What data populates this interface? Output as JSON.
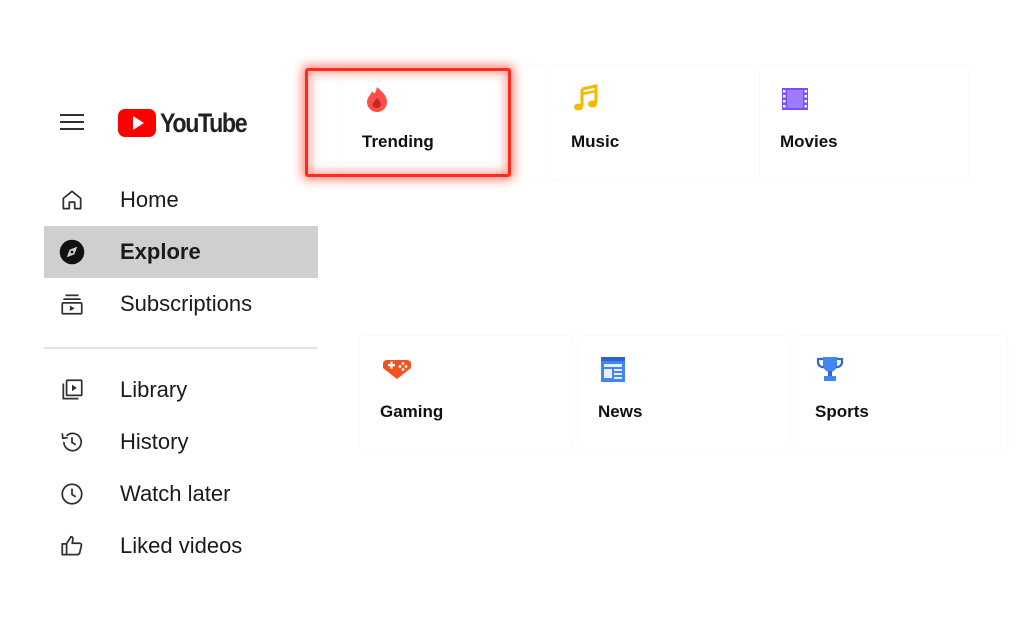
{
  "app": {
    "logo_text": "YouTube",
    "brand_color": "#ff0000"
  },
  "sidebar": {
    "items": [
      {
        "label": "Home",
        "icon": "home-icon",
        "active": false
      },
      {
        "label": "Explore",
        "icon": "explore-icon",
        "active": true
      },
      {
        "label": "Subscriptions",
        "icon": "subscriptions-icon",
        "active": false
      }
    ],
    "library_items": [
      {
        "label": "Library",
        "icon": "library-icon"
      },
      {
        "label": "History",
        "icon": "history-icon"
      },
      {
        "label": "Watch later",
        "icon": "clock-icon"
      },
      {
        "label": "Liked videos",
        "icon": "thumbs-up-icon"
      }
    ]
  },
  "categories": [
    {
      "label": "Trending",
      "icon": "trending-flame-icon",
      "color": "#ff4e45",
      "highlighted": true
    },
    {
      "label": "Music",
      "icon": "music-note-icon",
      "color": "#f9b800",
      "highlighted": false
    },
    {
      "label": "Movies",
      "icon": "film-icon",
      "color": "#7c4dff",
      "highlighted": false
    },
    {
      "label": "Gaming",
      "icon": "gamepad-icon",
      "color": "#f4511e",
      "highlighted": false
    },
    {
      "label": "News",
      "icon": "newspaper-icon",
      "color": "#4285f4",
      "highlighted": false
    },
    {
      "label": "Sports",
      "icon": "trophy-icon",
      "color": "#3367d6",
      "highlighted": false
    }
  ]
}
